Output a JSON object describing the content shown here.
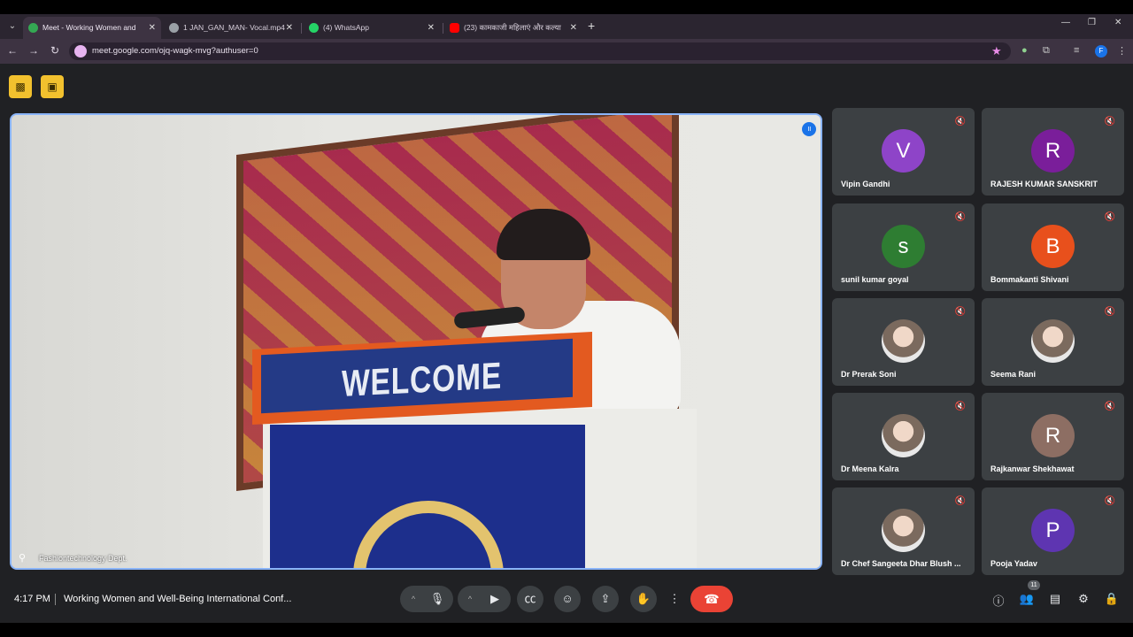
{
  "browser": {
    "tabs": [
      {
        "label": "Meet - Working Women and",
        "fav_color": "#34a853"
      },
      {
        "label": "1 JAN_GAN_MAN- Vocal.mp4",
        "fav_color": "#9aa0a6"
      },
      {
        "label": "(4) WhatsApp",
        "fav_color": "#25d366"
      },
      {
        "label": "(23) कामकाजी महिलाएं और कल्या",
        "fav_color": "#ff0000"
      }
    ],
    "url": "meet.google.com/ojq-wagk-mvg?authuser=0",
    "profile_initial": "F"
  },
  "stage": {
    "presenter_name": "Fashiontechnology Dept.",
    "podium_text": "WELCOME"
  },
  "participants": [
    {
      "name": "Vipin Gandhi",
      "initial": "V",
      "color": "#8e44c8",
      "photo": false
    },
    {
      "name": "RAJESH KUMAR SANSKRIT",
      "initial": "R",
      "color": "#7a1e9a",
      "photo": false
    },
    {
      "name": "sunil kumar goyal",
      "initial": "s",
      "color": "#2e7d32",
      "photo": false
    },
    {
      "name": "Bommakanti Shivani",
      "initial": "B",
      "color": "#e8501c",
      "photo": false
    },
    {
      "name": "Dr Prerak Soni",
      "initial": "",
      "color": "#ffffff",
      "photo": true
    },
    {
      "name": "Seema Rani",
      "initial": "",
      "color": "#ffffff",
      "photo": true
    },
    {
      "name": "Dr Meena Kalra",
      "initial": "",
      "color": "#ffffff",
      "photo": true
    },
    {
      "name": "Rajkanwar Shekhawat",
      "initial": "R",
      "color": "#8d6e63",
      "photo": false
    },
    {
      "name": "Dr Chef Sangeeta Dhar Blush ...",
      "initial": "",
      "color": "#ffffff",
      "photo": true
    },
    {
      "name": "Pooja Yadav",
      "initial": "P",
      "color": "#5e35b1",
      "photo": false
    }
  ],
  "bottom": {
    "time": "4:17 PM",
    "meeting_title": "Working Women and Well-Being International Conf...",
    "participant_count": "11"
  }
}
